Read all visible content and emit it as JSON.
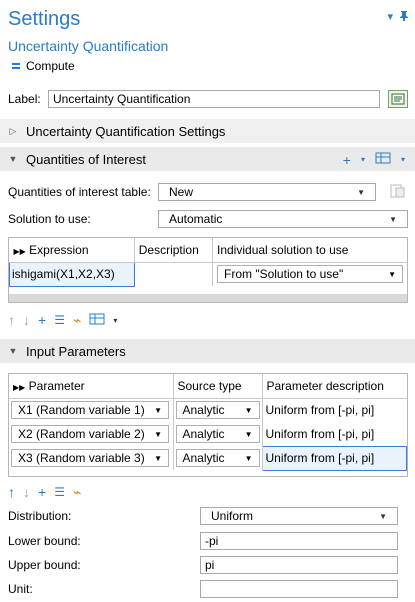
{
  "header": {
    "title": "Settings",
    "subtitle": "Uncertainty Quantification",
    "compute_label": "Compute"
  },
  "label_field": {
    "label": "Label:",
    "value": "Uncertainty Quantification"
  },
  "sections": {
    "uq_settings": "Uncertainty Quantification Settings",
    "qoi": "Quantities of Interest",
    "input_params": "Input Parameters"
  },
  "qoi": {
    "table_label": "Quantities of interest table:",
    "table_value": "New",
    "solution_label": "Solution to use:",
    "solution_value": "Automatic",
    "columns": [
      "Expression",
      "Description",
      "Individual solution to use"
    ],
    "rows": [
      {
        "expression": "ishigami(X1,X2,X3)",
        "description": "",
        "solution": "From \"Solution to use\""
      }
    ]
  },
  "input_parameters": {
    "columns": [
      "Parameter",
      "Source type",
      "Parameter description"
    ],
    "rows": [
      {
        "parameter": "X1 (Random variable 1)",
        "source": "Analytic",
        "description": "Uniform from [-pi, pi]"
      },
      {
        "parameter": "X2 (Random variable 2)",
        "source": "Analytic",
        "description": "Uniform from [-pi, pi]"
      },
      {
        "parameter": "X3 (Random variable 3)",
        "source": "Analytic",
        "description": "Uniform from [-pi, pi]"
      }
    ]
  },
  "distribution": {
    "distribution_label": "Distribution:",
    "distribution_value": "Uniform",
    "lower_label": "Lower bound:",
    "lower_value": "-pi",
    "upper_label": "Upper bound:",
    "upper_value": "pi",
    "unit_label": "Unit:",
    "unit_value": ""
  },
  "icons": {
    "pin": "pin-icon",
    "arrow_down": "arrow-down-icon",
    "add": "plus-icon",
    "move_up": "arrow-up-icon",
    "move_down": "arrow-down-icon",
    "delete": "delete-icon",
    "clear": "broom-icon",
    "table_settings": "table-icon"
  },
  "colors": {
    "accent": "#2a7cc6",
    "section_bg": "#eaeaea",
    "selected_cell": "#eaf2fc"
  }
}
